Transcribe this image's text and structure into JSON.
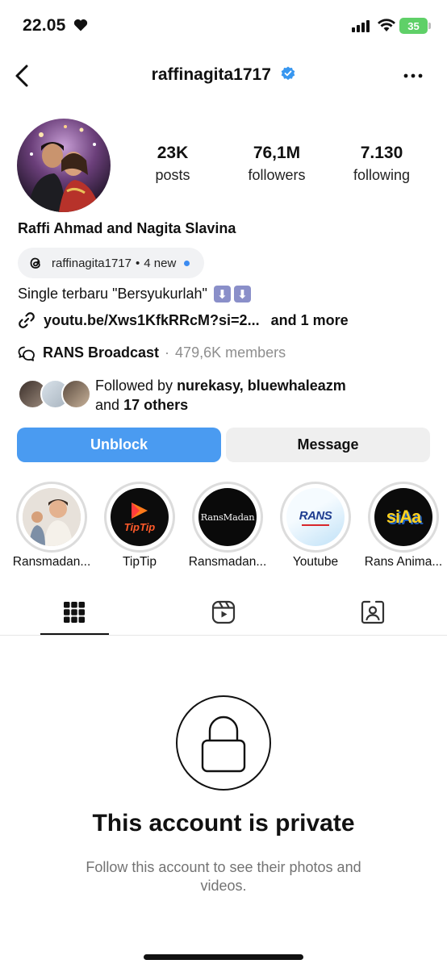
{
  "status_bar": {
    "time": "22.05",
    "battery": "35"
  },
  "header": {
    "username": "raffinagita1717",
    "back_icon": "chevron-left-icon",
    "more_icon": "ellipsis-icon",
    "verified_color": "#3897f0"
  },
  "profile": {
    "stats": [
      {
        "value": "23K",
        "label": "posts"
      },
      {
        "value": "76,1M",
        "label": "followers"
      },
      {
        "value": "7.130",
        "label": "following"
      }
    ],
    "full_name": "Raffi Ahmad and Nagita Slavina",
    "threads_badge": {
      "handle": "raffinagita1717",
      "dot": "•",
      "status": "4 new"
    },
    "bio": "Single terbaru \"Bersyukurlah\"",
    "link": {
      "url": "youtu.be/Xws1KfkRRcM?si=2...",
      "more": "and 1 more"
    },
    "channel": {
      "name": "RANS Broadcast",
      "sep": "·",
      "members": "479,6K members"
    },
    "followed_by": {
      "prefix": "Followed by",
      "names": "nurekasy, bluewhaleazm",
      "and": "and",
      "others": "17 others"
    }
  },
  "actions": {
    "unblock": "Unblock",
    "message": "Message",
    "accent_color": "#4a9bf1"
  },
  "highlights": [
    {
      "label": "Ransmadan..."
    },
    {
      "label": "TipTip",
      "art_text": "TipTip"
    },
    {
      "label": "Ransmadan...",
      "art_text": "RansMadan"
    },
    {
      "label": "Youtube",
      "art_text": "RANS"
    },
    {
      "label": "Rans Anima...",
      "art_text": "siAa"
    }
  ],
  "tabs": [
    {
      "icon": "grid-icon",
      "active": true
    },
    {
      "icon": "reels-icon",
      "active": false
    },
    {
      "icon": "tagged-icon",
      "active": false
    }
  ],
  "private_notice": {
    "title": "This account is private",
    "subtitle": "Follow this account to see their photos and videos."
  }
}
